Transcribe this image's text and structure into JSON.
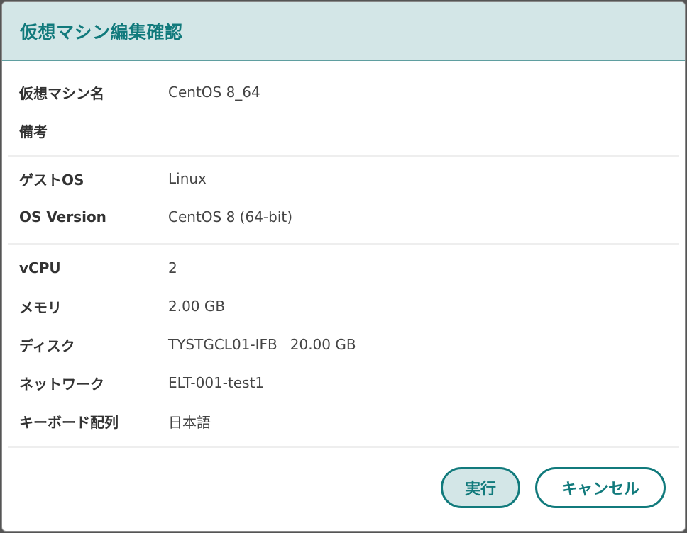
{
  "dialog": {
    "title": "仮想マシン編集確認"
  },
  "sections": [
    {
      "rows": [
        {
          "label": "仮想マシン名",
          "value": "CentOS 8_64"
        },
        {
          "label": "備考",
          "value": ""
        }
      ]
    },
    {
      "rows": [
        {
          "label": "ゲストOS",
          "value": "Linux"
        },
        {
          "label": "OS Version",
          "value": "CentOS 8 (64-bit)"
        }
      ]
    },
    {
      "rows": [
        {
          "label": "vCPU",
          "value": "2"
        },
        {
          "label": "メモリ",
          "value": "2.00 GB"
        },
        {
          "label": "ディスク",
          "value": "TYSTGCL01-IFB",
          "value2": "20.00 GB"
        },
        {
          "label": "ネットワーク",
          "value": "ELT-001-test1"
        },
        {
          "label": "キーボード配列",
          "value": "日本語"
        }
      ]
    }
  ],
  "buttons": {
    "execute_label": "実行",
    "cancel_label": "キャンセル"
  },
  "colors": {
    "accent": "#117a7c",
    "header_bg": "#d3e6e7"
  }
}
